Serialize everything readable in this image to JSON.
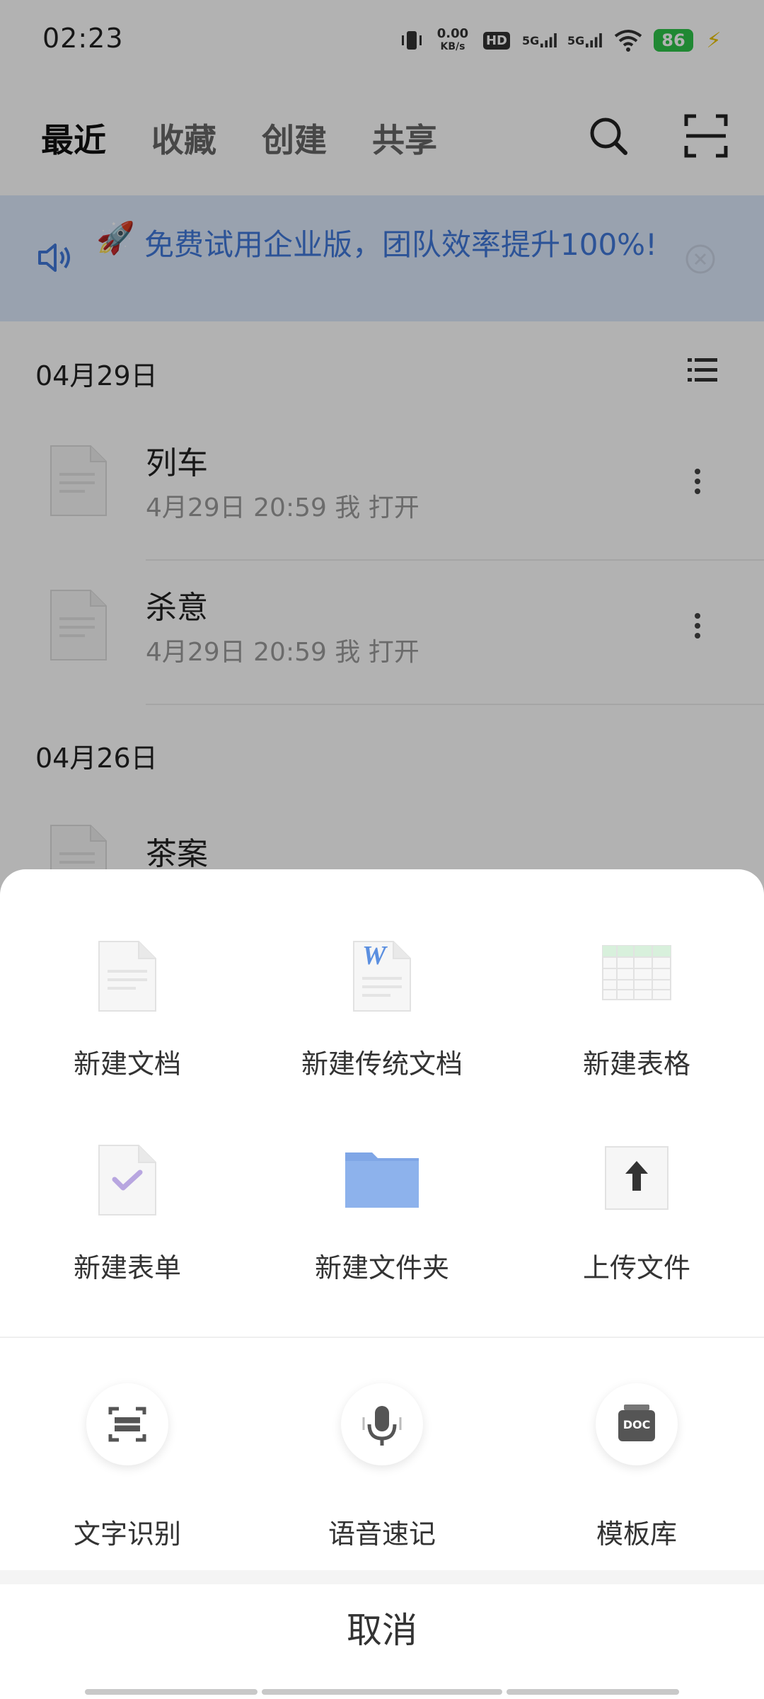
{
  "status_bar": {
    "time": "02:23",
    "network_speed_value": "0.00",
    "network_speed_unit": "KB/s",
    "hd_label": "HD",
    "sim1_label": "5G",
    "sim2_label": "5G",
    "battery": "86"
  },
  "top_nav": {
    "tabs": [
      {
        "label": "最近",
        "active": true
      },
      {
        "label": "收藏",
        "active": false
      },
      {
        "label": "创建",
        "active": false
      },
      {
        "label": "共享",
        "active": false
      }
    ],
    "search_icon": "search-icon",
    "scan_icon": "scan-icon"
  },
  "banner": {
    "emoji": "🚀",
    "text": "免费试用企业版，团队效率提升100%!",
    "accent_color": "#3f78d8",
    "background_color": "#dce8fb"
  },
  "file_sections": [
    {
      "date": "04月29日",
      "files": [
        {
          "title": "列车",
          "meta": "4月29日 20:59 我 打开"
        },
        {
          "title": "杀意",
          "meta": "4月29日 20:59 我 打开"
        }
      ]
    },
    {
      "date": "04月26日",
      "files": [
        {
          "title": "茶案",
          "meta": ""
        }
      ]
    }
  ],
  "sheet": {
    "create_items": [
      {
        "label": "新建文档",
        "icon": "doc-icon"
      },
      {
        "label": "新建传统文档",
        "icon": "word-doc-icon"
      },
      {
        "label": "新建表格",
        "icon": "spreadsheet-icon"
      },
      {
        "label": "新建表单",
        "icon": "form-icon"
      },
      {
        "label": "新建文件夹",
        "icon": "folder-icon"
      },
      {
        "label": "上传文件",
        "icon": "upload-icon"
      }
    ],
    "tool_items": [
      {
        "label": "文字识别",
        "icon": "ocr-scan-icon"
      },
      {
        "label": "语音速记",
        "icon": "microphone-icon"
      },
      {
        "label": "模板库",
        "icon": "doc-template-icon"
      }
    ],
    "doc_badge": "DOC",
    "word_badge": "W",
    "cancel_label": "取消"
  }
}
